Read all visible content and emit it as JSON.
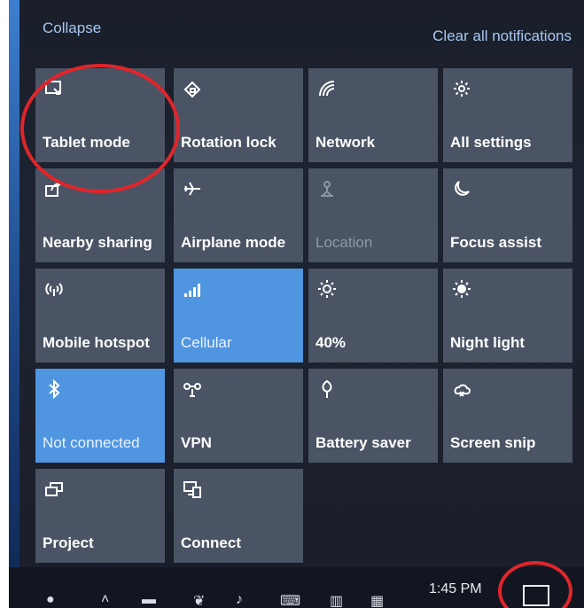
{
  "header": {
    "collapse_label": "Collapse",
    "clear_label": "Clear all notifications"
  },
  "tiles": [
    {
      "label": "Tablet mode",
      "icon": "tablet-mode-icon",
      "state": "off"
    },
    {
      "label": "Rotation lock",
      "icon": "rotation-lock-icon",
      "state": "off"
    },
    {
      "label": "Network",
      "icon": "network-icon",
      "state": "off"
    },
    {
      "label": "All settings",
      "icon": "gear-icon",
      "state": "off"
    },
    {
      "label": "Nearby sharing",
      "icon": "share-icon",
      "state": "off"
    },
    {
      "label": "Airplane mode",
      "icon": "airplane-icon",
      "state": "off"
    },
    {
      "label": "Location",
      "icon": "location-icon",
      "state": "disabled"
    },
    {
      "label": "Focus assist",
      "icon": "moon-icon",
      "state": "off"
    },
    {
      "label": "Mobile hotspot",
      "icon": "hotspot-icon",
      "state": "off"
    },
    {
      "label": "Cellular",
      "icon": "cellular-icon",
      "state": "on"
    },
    {
      "label": "40%",
      "icon": "brightness-icon",
      "state": "off"
    },
    {
      "label": "Night light",
      "icon": "night-light-icon",
      "state": "off"
    },
    {
      "label": "Not connected",
      "icon": "bluetooth-icon",
      "state": "on"
    },
    {
      "label": "VPN",
      "icon": "vpn-icon",
      "state": "off"
    },
    {
      "label": "Battery saver",
      "icon": "battery-saver-icon",
      "state": "off"
    },
    {
      "label": "Screen snip",
      "icon": "screen-snip-icon",
      "state": "off"
    },
    {
      "label": "Project",
      "icon": "project-icon",
      "state": "off"
    },
    {
      "label": "Connect",
      "icon": "connect-icon",
      "state": "off"
    }
  ],
  "taskbar": {
    "time": "1:45 PM"
  },
  "colors": {
    "tile": "#4a5464",
    "tile_active": "#4f95e0",
    "link": "#a9c7f0",
    "highlight_ring": "#e0252b"
  }
}
